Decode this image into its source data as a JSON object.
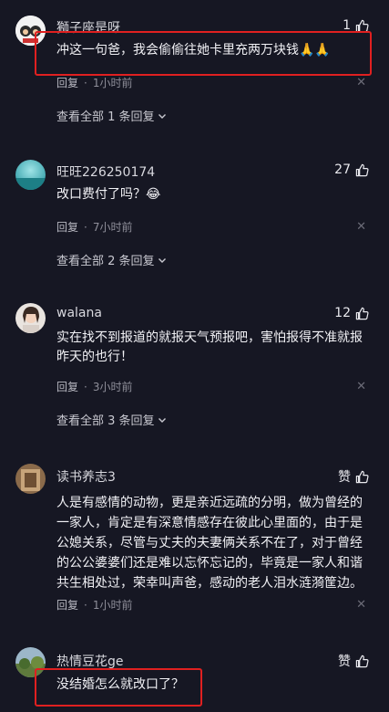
{
  "comments": [
    {
      "username": "獅子座是呀",
      "likes": "1",
      "content": "冲这一句爸，我会偷偷往她卡里充两万块钱🙏🙏",
      "reply_label": "回复",
      "time": "1小时前",
      "expand_label": "查看全部 1 条回复"
    },
    {
      "username": "旺旺226250174",
      "likes": "27",
      "content": "改口费付了吗？😂",
      "reply_label": "回复",
      "time": "7小时前",
      "expand_label": "查看全部 2 条回复"
    },
    {
      "username": "walana",
      "likes": "12",
      "content": "实在找不到报道的就报天气预报吧，害怕报得不准就报昨天的也行！",
      "reply_label": "回复",
      "time": "3小时前",
      "expand_label": "查看全部 3 条回复"
    },
    {
      "username": "读书养志3",
      "likes": "赞",
      "content": "人是有感情的动物，更是亲近远疏的分明，做为曾经的一家人，肯定是有深意情感存在彼此心里面的，由于是公媳关系，尽管与丈夫的夫妻俩关系不在了，对于曾经的公公婆婆们还是难以忘怀忘记的，毕竟是一家人和谐共生相处过，荣幸叫声爸，感动的老人泪水涟漪筐边。",
      "reply_label": "回复",
      "time": "1小时前"
    },
    {
      "username": "热情豆花ge",
      "likes": "赞",
      "content": "没结婚怎么就改口了？"
    }
  ],
  "icons": {
    "like": "thumbs-up-icon",
    "close": "close-icon",
    "expand": "chevron-down-icon"
  },
  "colors": {
    "background": "#161723",
    "highlight": "#e02020"
  }
}
